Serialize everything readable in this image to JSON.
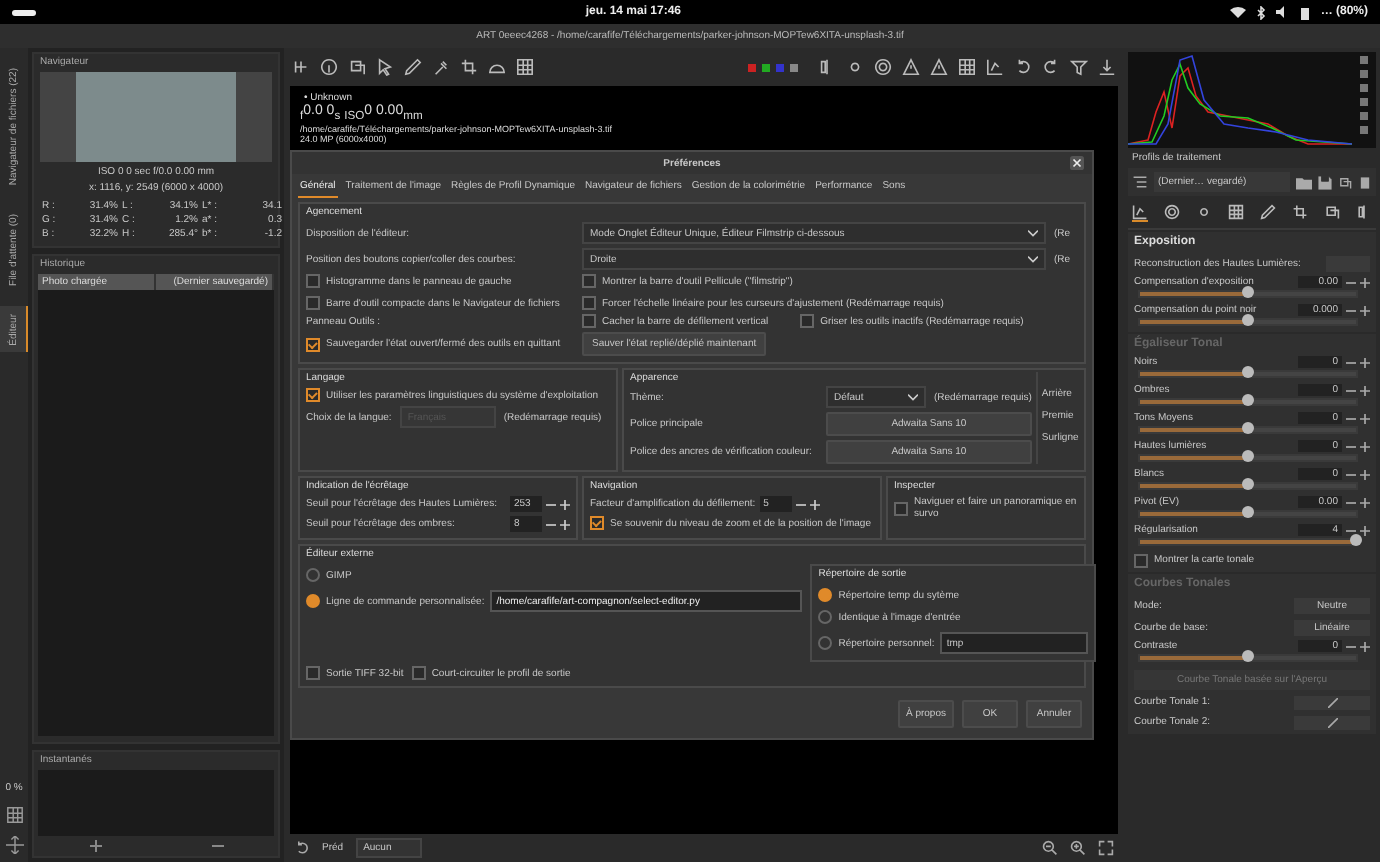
{
  "system_bar": {
    "clock": "jeu. 14 mai  17:46",
    "battery": "… (80%)"
  },
  "window_title": "ART 0eeec4268 - /home/carafife/Téléchargements/parker-johnson-MOPTew6XITA-unsplash-3.tif",
  "left_tabs": [
    {
      "label": "Navigateur de fichiers (22)",
      "selected": false
    },
    {
      "label": "File d'attente (0)",
      "selected": false
    },
    {
      "label": "Éditeur",
      "selected": true
    }
  ],
  "zoom_level": "0 %",
  "navigator": {
    "title": "Navigateur",
    "exif": "ISO 0    0 sec    f/0.0    0.00 mm",
    "coords": "x: 1116, y: 2549    (6000 x 4000)",
    "readings": [
      [
        "R :",
        "31.4%",
        "L :",
        "34.1%",
        "L* :",
        "34.1"
      ],
      [
        "G :",
        "31.4%",
        "C :",
        "1.2%",
        "a* :",
        "0.3"
      ],
      [
        "B :",
        "32.2%",
        "H :",
        "285.4°",
        "b* :",
        "-1.2"
      ]
    ]
  },
  "history": {
    "title": "Historique",
    "rows": [
      {
        "action": "Photo chargée",
        "state": "(Dernier sauvegardé)"
      }
    ]
  },
  "snapshots": {
    "title": "Instantanés"
  },
  "image_info": {
    "label": "• Unknown",
    "exposure": "$_{f}$0.0  0$_{s}$  $_{ISO}$0  0.00$_{mm}$",
    "path": "/home/carafife/Téléchargements/parker-johnson-MOPTew6XITA-unsplash-3.tif",
    "size": "24.0 MP (6000x4000)"
  },
  "bottom_bar": {
    "label": "Préd",
    "profile": "Aucun"
  },
  "preferences": {
    "title": "Préférences",
    "tabs": [
      {
        "label": "Général",
        "selected": true
      },
      {
        "label": "Traitement de l'image",
        "selected": false
      },
      {
        "label": "Règles de Profil Dynamique",
        "selected": false
      },
      {
        "label": "Navigateur de fichiers",
        "selected": false
      },
      {
        "label": "Gestion de la colorimétrie",
        "selected": false
      },
      {
        "label": "Performance",
        "selected": false
      },
      {
        "label": "Sons",
        "selected": false
      }
    ],
    "layout": {
      "legend": "Agencement",
      "selects": [
        {
          "label": "Disposition de l'éditeur:",
          "value": "Mode Onglet Éditeur Unique, Éditeur Filmstrip ci-dessous",
          "note": "(Re"
        },
        {
          "label": "Position des boutons copier/coller des courbes:",
          "value": "Droite",
          "note": "(Re"
        }
      ],
      "checks": [
        {
          "label": "Histogramme dans le panneau de gauche",
          "checked": false
        },
        {
          "label": "Montrer la barre d'outil Pellicule (\"filmstrip\")",
          "checked": false
        },
        {
          "label": "Barre d'outil compacte dans le Navigateur de fichiers",
          "checked": false
        },
        {
          "label": "Forcer l'échelle linéaire pour les curseurs d'ajustement (Redémarrage requis)",
          "checked": false
        }
      ],
      "tools_label": "Panneau Outils :",
      "tools_checks": [
        {
          "label": "Cacher la barre de défilement vertical",
          "checked": false
        },
        {
          "label": "Griser les outils inactifs (Redémarrage requis)",
          "checked": false
        }
      ],
      "save_check": {
        "label": "Sauvegarder l'état ouvert/fermé des outils en quittant",
        "checked": true
      },
      "save_button": "Sauver l'état replié/déplié maintenant"
    },
    "language": {
      "legend": "Langage",
      "check": {
        "label": "Utiliser les paramètres linguistiques du système d'exploitation",
        "checked": true
      },
      "label": "Choix de la langue:",
      "value": "Français",
      "disabled": true,
      "note": "(Redémarrage requis)"
    },
    "appearance": {
      "legend": "Apparence",
      "theme_label": "Thème:",
      "theme": "Défaut",
      "theme_note": "(Redémarrage requis)",
      "fonts": [
        {
          "label": "Police principale",
          "value": "Adwaita Sans 10"
        },
        {
          "label": "Police des ancres de vérification couleur:",
          "value": "Adwaita Sans 10"
        }
      ],
      "cut_labels": [
        "Arrière",
        "Premie",
        "Surligne"
      ]
    },
    "clipping": {
      "legend": "Indication de l'écrêtage",
      "spins": [
        {
          "label": "Seuil pour l'écrêtage des Hautes Lumières:",
          "value": "253"
        },
        {
          "label": "Seuil pour l'écrêtage des ombres:",
          "value": "8"
        }
      ]
    },
    "navigation": {
      "legend": "Navigation",
      "spin": {
        "label": "Facteur d'amplification du défilement:",
        "value": "5"
      },
      "check": {
        "label": "Se souvenir du niveau de zoom et de la position de l'image",
        "checked": true
      }
    },
    "inspect": {
      "legend": "Inspecter",
      "check": {
        "label": "Naviguer et faire un panoramique en survo",
        "checked": false
      }
    },
    "external": {
      "legend": "Éditeur externe",
      "radios": [
        {
          "label": "GIMP",
          "selected": false
        },
        {
          "label": "Ligne de commande personnalisée:",
          "selected": true,
          "value": "/home/carafife/art-compagnon/select-editor.py"
        }
      ],
      "checks": [
        {
          "label": "Sortie TIFF 32-bit",
          "checked": false
        },
        {
          "label": "Court-circuiter le profil de sortie",
          "checked": false
        }
      ],
      "output": {
        "legend": "Répertoire de sortie",
        "radios": [
          {
            "label": "Répertoire temp du sytème",
            "selected": true
          },
          {
            "label": "Identique à l'image d'entrée",
            "selected": false
          },
          {
            "label": "Répertoire personnel:",
            "selected": false,
            "value": "tmp"
          }
        ]
      }
    },
    "buttons": [
      "À propos",
      "OK",
      "Annuler"
    ]
  },
  "right_panel": {
    "profiles_label": "Profils de traitement",
    "profile": "(Dernier… vegardé)",
    "sections": [
      {
        "title": "Exposition",
        "enabled": true,
        "rows": [
          {
            "kind": "select",
            "label": "Reconstruction des Hautes Lumières:"
          },
          {
            "kind": "slider",
            "label": "Compensation d'exposition",
            "value": "0.00",
            "level": 0.5
          },
          {
            "kind": "slider",
            "label": "Compensation du point noir",
            "value": "0.000",
            "level": 0.5
          }
        ]
      },
      {
        "title": "Égaliseur Tonal",
        "enabled": false,
        "rows": [
          {
            "kind": "slider",
            "label": "Noirs",
            "value": "0",
            "level": 0.5
          },
          {
            "kind": "slider",
            "label": "Ombres",
            "value": "0",
            "level": 0.5
          },
          {
            "kind": "slider",
            "label": "Tons Moyens",
            "value": "0",
            "level": 0.5
          },
          {
            "kind": "slider",
            "label": "Hautes lumières",
            "value": "0",
            "level": 0.5
          },
          {
            "kind": "slider",
            "label": "Blancs",
            "value": "0",
            "level": 0.5
          },
          {
            "kind": "slider",
            "label": "Pivot (EV)",
            "value": "0.00",
            "level": 0.5
          },
          {
            "kind": "slider",
            "label": "Régularisation",
            "value": "4",
            "level": 1
          },
          {
            "kind": "checkbox",
            "label": "Montrer la carte tonale",
            "checked": false
          }
        ]
      },
      {
        "title": "Courbes Tonales",
        "enabled": false,
        "rows": [
          {
            "kind": "select",
            "label": "Mode:",
            "value": "Neutre"
          },
          {
            "kind": "select",
            "label": "Courbe de base:",
            "value": "Linéaire"
          },
          {
            "kind": "slider",
            "label": "Contraste",
            "value": "0",
            "level": 0.5
          },
          {
            "kind": "button",
            "label": "Courbe Tonale basée sur l'Aperçu"
          },
          {
            "kind": "curve",
            "label": "Courbe Tonale 1:"
          },
          {
            "kind": "curve",
            "label": "Courbe Tonale 2:"
          }
        ]
      }
    ]
  }
}
